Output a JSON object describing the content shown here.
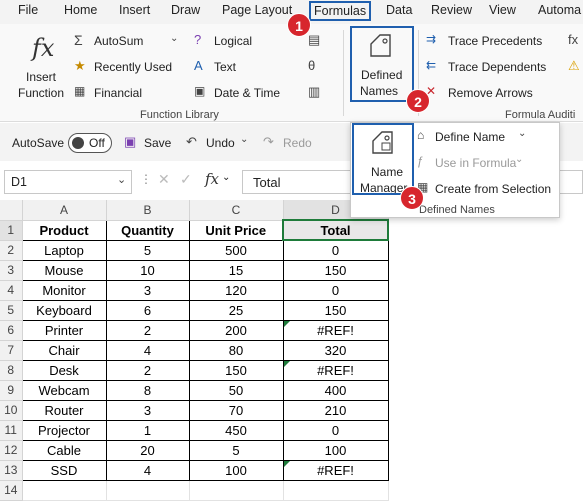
{
  "menubar": {
    "items": [
      "File",
      "Home",
      "Insert",
      "Draw",
      "Page Layout",
      "Formulas",
      "Data",
      "Review",
      "View",
      "Automa"
    ]
  },
  "ribbon": {
    "insert_function": [
      "Insert",
      "Function"
    ],
    "autosum": "AutoSum",
    "recently_used": "Recently Used",
    "financial": "Financial",
    "logical": "Logical",
    "text": "Text",
    "date_time": "Date & Time",
    "function_library_label": "Function Library",
    "defined_names": [
      "Defined",
      "Names"
    ],
    "trace_precedents": "Trace Precedents",
    "trace_dependents": "Trace Dependents",
    "remove_arrows": "Remove Arrows",
    "formula_auditing_label": "Formula Auditi"
  },
  "qat": {
    "autosave": "AutoSave",
    "toggle": "Off",
    "save": "Save",
    "undo": "Undo",
    "redo": "Redo"
  },
  "formula_bar": {
    "name_box": "D1",
    "fx": "fx",
    "content": "Total"
  },
  "defined_names_panel": {
    "name_manager": [
      "Name",
      "Manager"
    ],
    "define_name": "Define Name",
    "use_in_formula": "Use in Formula",
    "create_from_selection": "Create from Selection",
    "group_label": "Defined Names"
  },
  "badges": [
    "1",
    "2",
    "3"
  ],
  "sheet": {
    "columns": [
      "A",
      "B",
      "C",
      "D"
    ],
    "rows": [
      {
        "n": "1",
        "cells": [
          "Product",
          "Quantity",
          "Unit Price",
          "Total"
        ]
      },
      {
        "n": "2",
        "cells": [
          "Laptop",
          "5",
          "500",
          "0"
        ]
      },
      {
        "n": "3",
        "cells": [
          "Mouse",
          "10",
          "15",
          "150"
        ]
      },
      {
        "n": "4",
        "cells": [
          "Monitor",
          "3",
          "120",
          "0"
        ]
      },
      {
        "n": "5",
        "cells": [
          "Keyboard",
          "6",
          "25",
          "150"
        ]
      },
      {
        "n": "6",
        "cells": [
          "Printer",
          "2",
          "200",
          "#REF!"
        ]
      },
      {
        "n": "7",
        "cells": [
          "Chair",
          "4",
          "80",
          "320"
        ]
      },
      {
        "n": "8",
        "cells": [
          "Desk",
          "2",
          "150",
          "#REF!"
        ]
      },
      {
        "n": "9",
        "cells": [
          "Webcam",
          "8",
          "50",
          "400"
        ]
      },
      {
        "n": "10",
        "cells": [
          "Router",
          "3",
          "70",
          "210"
        ]
      },
      {
        "n": "11",
        "cells": [
          "Projector",
          "1",
          "450",
          "0"
        ]
      },
      {
        "n": "12",
        "cells": [
          "Cable",
          "20",
          "5",
          "100"
        ]
      },
      {
        "n": "13",
        "cells": [
          "SSD",
          "4",
          "100",
          "#REF!"
        ]
      },
      {
        "n": "14",
        "cells": [
          "",
          "",
          "",
          ""
        ]
      }
    ]
  },
  "colors": {
    "accent_blue": "#1f5fae",
    "badge_red": "#d7262d",
    "error_marker": "#1e7b3a"
  }
}
